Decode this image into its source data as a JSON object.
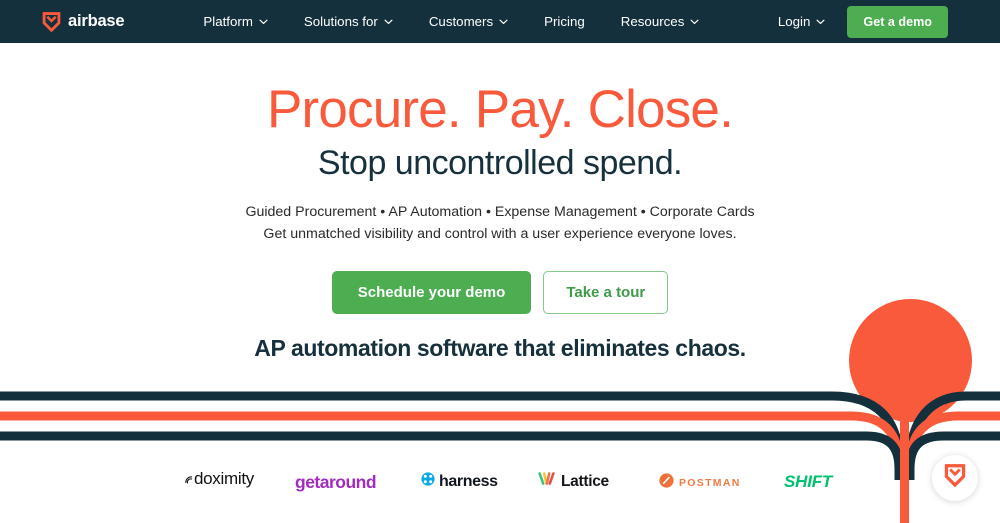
{
  "brand": {
    "name": "airbase",
    "logo_icon": "airbase-chevron-shield-icon",
    "logo_color": "#fa5a3c"
  },
  "colors": {
    "navy": "#14303c",
    "orange": "#fa5a3c",
    "green": "#4cad51",
    "green_outline": "#84c98a",
    "white": "#ffffff"
  },
  "navbar": {
    "items": [
      {
        "label": "Platform",
        "has_dropdown": true,
        "icon": "chevron-down-icon"
      },
      {
        "label": "Solutions for",
        "has_dropdown": true,
        "icon": "chevron-down-icon"
      },
      {
        "label": "Customers",
        "has_dropdown": true,
        "icon": "chevron-down-icon"
      },
      {
        "label": "Pricing",
        "has_dropdown": false,
        "icon": ""
      },
      {
        "label": "Resources",
        "has_dropdown": true,
        "icon": "chevron-down-icon"
      }
    ],
    "login": {
      "label": "Login",
      "icon": "chevron-down-icon"
    },
    "cta": {
      "label": "Get a demo"
    }
  },
  "hero": {
    "headline": "Procure. Pay. Close.",
    "subheadline": "Stop uncontrolled spend.",
    "features_line": "Guided Procurement • AP Automation • Expense Management • Corporate Cards",
    "value_line": "Get unmatched visibility and control with a user experience everyone loves.",
    "primary_cta": "Schedule your demo",
    "secondary_cta": "Take a tour",
    "tagline": "AP automation software that eliminates chaos.",
    "decor_circle": "orange-circle-decoration"
  },
  "pipes": {
    "description": "three-horizontal-pipes-merging-into-vertical-trunk",
    "stripe_colors": [
      "#14303c",
      "#fa5a3c",
      "#14303c"
    ]
  },
  "logos": {
    "items": [
      {
        "name": "doximity",
        "label": "doximity",
        "color": "#111111"
      },
      {
        "name": "getaround",
        "label": "getaround",
        "color": "#a32bc0"
      },
      {
        "name": "harness",
        "label": "harness",
        "color": "#12171f",
        "icon_color": "#0ba8e5"
      },
      {
        "name": "lattice",
        "label": "Lattice",
        "color": "#16161a"
      },
      {
        "name": "postman",
        "label": "POSTMAN",
        "color": "#f07a45"
      },
      {
        "name": "shift",
        "label": "SHIFT",
        "color": "#00c26e"
      }
    ]
  },
  "chat": {
    "icon": "airbase-chevron-logo-icon",
    "aria": "Open chat"
  }
}
